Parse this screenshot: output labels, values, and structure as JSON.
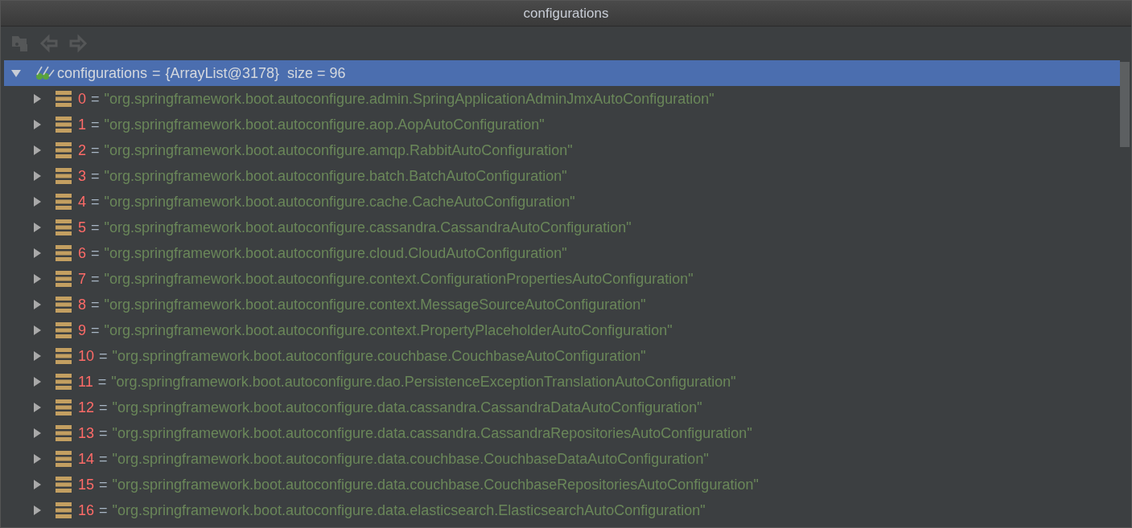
{
  "window": {
    "title": "configurations"
  },
  "toolbar": [
    {
      "kind": "frames",
      "disabled": true
    },
    {
      "kind": "back",
      "disabled": true
    },
    {
      "kind": "forward",
      "disabled": true
    }
  ],
  "tree": {
    "name": "configurations",
    "sep": "=",
    "value": "{ArrayList@3178}  size = 96",
    "expanded": true,
    "selected": true,
    "children": [
      {
        "name": "0",
        "sep": "=",
        "value": "\"org.springframework.boot.autoconfigure.admin.SpringApplicationAdminJmxAutoConfiguration\"",
        "expanded": false,
        "selected": false
      },
      {
        "name": "1",
        "sep": "=",
        "value": "\"org.springframework.boot.autoconfigure.aop.AopAutoConfiguration\"",
        "expanded": false,
        "selected": false
      },
      {
        "name": "2",
        "sep": "=",
        "value": "\"org.springframework.boot.autoconfigure.amqp.RabbitAutoConfiguration\"",
        "expanded": false,
        "selected": false
      },
      {
        "name": "3",
        "sep": "=",
        "value": "\"org.springframework.boot.autoconfigure.batch.BatchAutoConfiguration\"",
        "expanded": false,
        "selected": false
      },
      {
        "name": "4",
        "sep": "=",
        "value": "\"org.springframework.boot.autoconfigure.cache.CacheAutoConfiguration\"",
        "expanded": false,
        "selected": false
      },
      {
        "name": "5",
        "sep": "=",
        "value": "\"org.springframework.boot.autoconfigure.cassandra.CassandraAutoConfiguration\"",
        "expanded": false,
        "selected": false
      },
      {
        "name": "6",
        "sep": "=",
        "value": "\"org.springframework.boot.autoconfigure.cloud.CloudAutoConfiguration\"",
        "expanded": false,
        "selected": false
      },
      {
        "name": "7",
        "sep": "=",
        "value": "\"org.springframework.boot.autoconfigure.context.ConfigurationPropertiesAutoConfiguration\"",
        "expanded": false,
        "selected": false
      },
      {
        "name": "8",
        "sep": "=",
        "value": "\"org.springframework.boot.autoconfigure.context.MessageSourceAutoConfiguration\"",
        "expanded": false,
        "selected": false
      },
      {
        "name": "9",
        "sep": "=",
        "value": "\"org.springframework.boot.autoconfigure.context.PropertyPlaceholderAutoConfiguration\"",
        "expanded": false,
        "selected": false
      },
      {
        "name": "10",
        "sep": "=",
        "value": "\"org.springframework.boot.autoconfigure.couchbase.CouchbaseAutoConfiguration\"",
        "expanded": false,
        "selected": false
      },
      {
        "name": "11",
        "sep": "=",
        "value": "\"org.springframework.boot.autoconfigure.dao.PersistenceExceptionTranslationAutoConfiguration\"",
        "expanded": false,
        "selected": false
      },
      {
        "name": "12",
        "sep": "=",
        "value": "\"org.springframework.boot.autoconfigure.data.cassandra.CassandraDataAutoConfiguration\"",
        "expanded": false,
        "selected": false
      },
      {
        "name": "13",
        "sep": "=",
        "value": "\"org.springframework.boot.autoconfigure.data.cassandra.CassandraRepositoriesAutoConfiguration\"",
        "expanded": false,
        "selected": false
      },
      {
        "name": "14",
        "sep": "=",
        "value": "\"org.springframework.boot.autoconfigure.data.couchbase.CouchbaseDataAutoConfiguration\"",
        "expanded": false,
        "selected": false
      },
      {
        "name": "15",
        "sep": "=",
        "value": "\"org.springframework.boot.autoconfigure.data.couchbase.CouchbaseRepositoriesAutoConfiguration\"",
        "expanded": false,
        "selected": false
      },
      {
        "name": "16",
        "sep": "=",
        "value": "\"org.springframework.boot.autoconfigure.data.elasticsearch.ElasticsearchAutoConfiguration\"",
        "expanded": false,
        "selected": false
      }
    ]
  }
}
